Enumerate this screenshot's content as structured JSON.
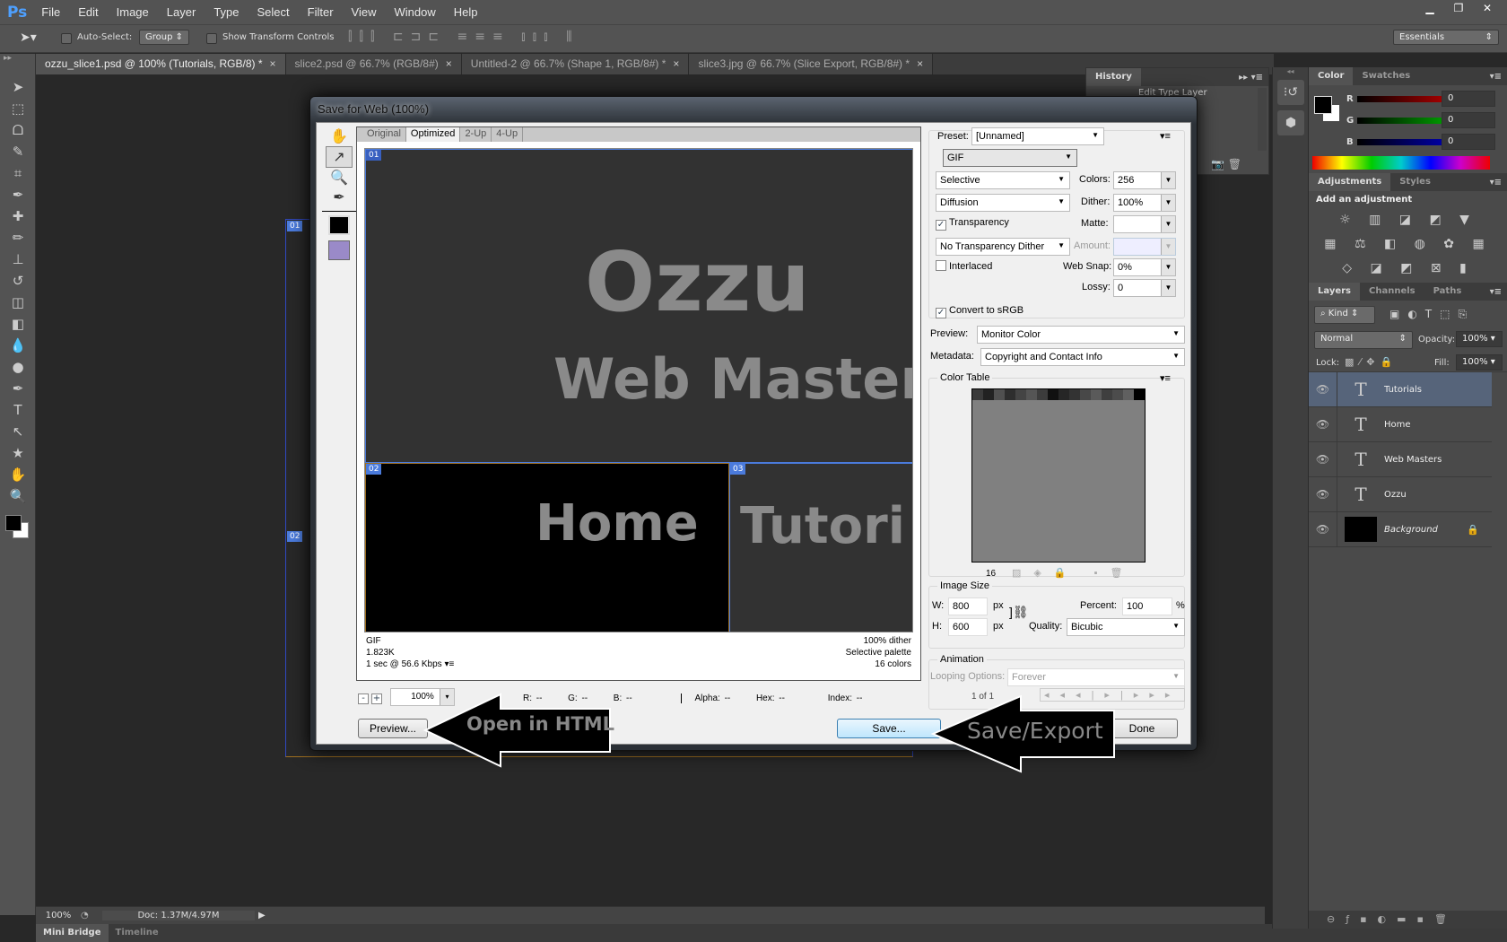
{
  "app": {
    "logo": "Ps"
  },
  "menu": [
    "File",
    "Edit",
    "Image",
    "Layer",
    "Type",
    "Select",
    "Filter",
    "View",
    "Window",
    "Help"
  ],
  "window_controls": {
    "minimize": "▁",
    "restore": "❐",
    "close": "✕"
  },
  "options_bar": {
    "auto_select_label": "Auto-Select:",
    "auto_select_value": "Group",
    "show_transform_label": "Show Transform Controls",
    "workspace": "Essentials"
  },
  "doc_tabs": [
    {
      "label": "ozzu_slice1.psd @ 100% (Tutorials, RGB/8) *",
      "active": true
    },
    {
      "label": "slice2.psd @ 66.7% (RGB/8#)",
      "active": false
    },
    {
      "label": "Untitled-2 @ 66.7% (Shape 1, RGB/8#) *",
      "active": false
    },
    {
      "label": "slice3.jpg @ 66.7% (Slice Export, RGB/8#) *",
      "active": false
    }
  ],
  "tools": [
    "move",
    "marquee",
    "lasso",
    "quick-select",
    "crop",
    "eyedropper",
    "healing",
    "brush",
    "stamp",
    "history-brush",
    "eraser",
    "gradient",
    "blur",
    "dodge",
    "pen",
    "type",
    "path-select",
    "shape",
    "hand",
    "zoom"
  ],
  "tool_glyphs": [
    "➤",
    "⬚",
    "ᗝ",
    "✎",
    "⌗",
    "✒",
    "✚",
    "✏",
    "⊥",
    "↺",
    "◫",
    "◧",
    "💧",
    "●",
    "✒",
    "T",
    "↖",
    "★",
    "✋",
    "🔍"
  ],
  "status_bar": {
    "zoom": "100%",
    "doc": "Doc: 1.37M/4.97M"
  },
  "bottom_tabs": [
    {
      "label": "Mini Bridge",
      "active": true
    },
    {
      "label": "Timeline",
      "active": false
    }
  ],
  "history": {
    "tab": "History",
    "item": "Edit Type Layer"
  },
  "color_panel": {
    "tabs": [
      "Color",
      "Swatches"
    ],
    "r_label": "R",
    "g_label": "G",
    "b_label": "B",
    "r": "0",
    "g": "0",
    "b": "0"
  },
  "adjustments_panel": {
    "tabs": [
      "Adjustments",
      "Styles"
    ],
    "heading": "Add an adjustment"
  },
  "layers_panel": {
    "tabs": [
      "Layers",
      "Channels",
      "Paths"
    ],
    "kind": "Kind",
    "blend_mode": "Normal",
    "opacity_label": "Opacity:",
    "opacity": "100%",
    "lock_label": "Lock:",
    "fill_label": "Fill:",
    "fill": "100%",
    "layers": [
      {
        "name": "Tutorials",
        "type": "text",
        "selected": true
      },
      {
        "name": "Home",
        "type": "text",
        "selected": false
      },
      {
        "name": "Web Masters",
        "type": "text",
        "selected": false
      },
      {
        "name": "Ozzu",
        "type": "text",
        "selected": false
      },
      {
        "name": "Background",
        "type": "image",
        "selected": false,
        "locked": true
      }
    ]
  },
  "dialog": {
    "title": "Save for Web (100%)",
    "view_tabs": [
      {
        "label": "Original"
      },
      {
        "label": "Optimized",
        "active": true
      },
      {
        "label": "2-Up"
      },
      {
        "label": "4-Up"
      }
    ],
    "slices": [
      "01",
      "02",
      "03"
    ],
    "preview_text": {
      "line1": "Ozzu",
      "line2": "Web Masters",
      "home": "Home",
      "tutorials": "Tutori"
    },
    "info_left": [
      "GIF",
      "1.823K",
      "1 sec @ 56.6 Kbps"
    ],
    "info_right": [
      "100% dither",
      "Selective palette",
      "16 colors"
    ],
    "zoom": "100%",
    "readout": {
      "r": "R: --",
      "g": "G: --",
      "b": "B: --",
      "alpha": "Alpha: --",
      "hex": "Hex: --",
      "index": "Index: --"
    },
    "buttons": {
      "preview": "Preview...",
      "save": "Save...",
      "done": "Done"
    },
    "settings": {
      "preset_label": "Preset:",
      "preset": "[Unnamed]",
      "format": "GIF",
      "reduction": "Selective",
      "colors_label": "Colors:",
      "colors": "256",
      "dither_algo": "Diffusion",
      "dither_label": "Dither:",
      "dither": "100%",
      "transparency_label": "Transparency",
      "transparency": true,
      "matte_label": "Matte:",
      "matte": "",
      "trans_dither": "No Transparency Dither",
      "amount_label": "Amount:",
      "amount": "",
      "interlaced_label": "Interlaced",
      "interlaced": false,
      "websnap_label": "Web Snap:",
      "websnap": "0%",
      "lossy_label": "Lossy:",
      "lossy": "0",
      "convert_srgb_label": "Convert to sRGB",
      "convert_srgb": true,
      "preview_label": "Preview:",
      "preview": "Monitor Color",
      "metadata_label": "Metadata:",
      "metadata": "Copyright and Contact Info"
    },
    "color_table": {
      "label": "Color Table",
      "count": "16",
      "swatches": [
        "#3a3a3a",
        "#222",
        "#505050",
        "#2e2e2e",
        "#444",
        "#555",
        "#3c3c3c",
        "#111",
        "#262626",
        "#333",
        "#484848",
        "#5a5a5a",
        "#3f3f3f",
        "#4c4c4c",
        "#606060",
        "#000"
      ]
    },
    "image_size": {
      "label": "Image Size",
      "w_label": "W:",
      "w": "800",
      "h_label": "H:",
      "h": "600",
      "unit": "px",
      "percent_label": "Percent:",
      "percent": "100",
      "percent_unit": "%",
      "quality_label": "Quality:",
      "quality": "Bicubic"
    },
    "animation": {
      "label": "Animation",
      "looping_label": "Looping Options:",
      "looping": "Forever",
      "frame": "1 of 1"
    }
  },
  "annotations": {
    "open_html": "Open in HTML",
    "save_export": "Save/Export"
  }
}
